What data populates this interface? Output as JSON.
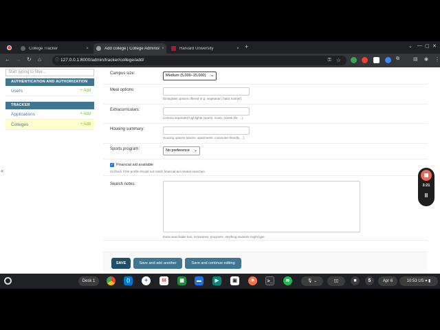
{
  "browser": {
    "tabs": [
      {
        "title": "College Tracker",
        "close": "×",
        "favicon_color": "#5f6368"
      },
      {
        "title": "Add college | College Administration",
        "close": "×",
        "favicon_color": "#9aa0a6"
      },
      {
        "title": "Harvard University",
        "close": "×",
        "favicon_color": "#a51c30"
      }
    ],
    "new_tab": "+",
    "window_controls": {
      "minimize": "—",
      "maximize": "▢",
      "close": "✕",
      "dropdown": "⌄"
    },
    "nav": {
      "back": "←",
      "forward": "→",
      "reload": "↻",
      "home": "⌂"
    },
    "url": "127.0.0.1:8000/admin/tracker/college/add/",
    "menu": "⋮"
  },
  "sidebar": {
    "filter_placeholder": "Start typing to filter...",
    "modules": [
      {
        "title": "AUTHENTICATION AND AUTHORIZATION",
        "items": [
          {
            "label": "Users",
            "add": "+ Add"
          }
        ]
      },
      {
        "title": "TRACKER",
        "items": [
          {
            "label": "Applications",
            "add": "+ Add"
          },
          {
            "label": "Colleges",
            "add": "+ Add"
          }
        ]
      }
    ],
    "collapse": "«"
  },
  "form": {
    "campus_size": {
      "label": "Campus size:",
      "value": "Medium (5,000–15,000)"
    },
    "meal_options": {
      "label": "Meal options:",
      "help": "Dining/diet options offered (e.g. vegetarian, halal, kosher)."
    },
    "extracurriculars": {
      "label": "Extracurriculars:",
      "help": "Comma separated highlights (sports, music, Greek life, ...)."
    },
    "housing_summary": {
      "label": "Housing summary:",
      "help": "Housing options (dorms, apartments, commuter-friendly, ...)."
    },
    "sports_program": {
      "label": "Sports program:",
      "value": "No preference"
    },
    "financial_aid": {
      "label": "Financial aid available",
      "checked": true,
      "help": "Uncheck if the profile should not match financial-aid-related searches."
    },
    "search_notes": {
      "label": "Search notes:",
      "help": "Extra searchable text, nicknames, programs, anything students might type."
    }
  },
  "buttons": {
    "save": "SAVE",
    "save_add": "Save and add another",
    "save_continue": "Save and continue editing"
  },
  "recorder": {
    "time": "3:21",
    "pause": "II"
  },
  "shelf": {
    "desk": "Desk 1",
    "date": "Apr 6",
    "time": "10:53",
    "locale": "US"
  }
}
